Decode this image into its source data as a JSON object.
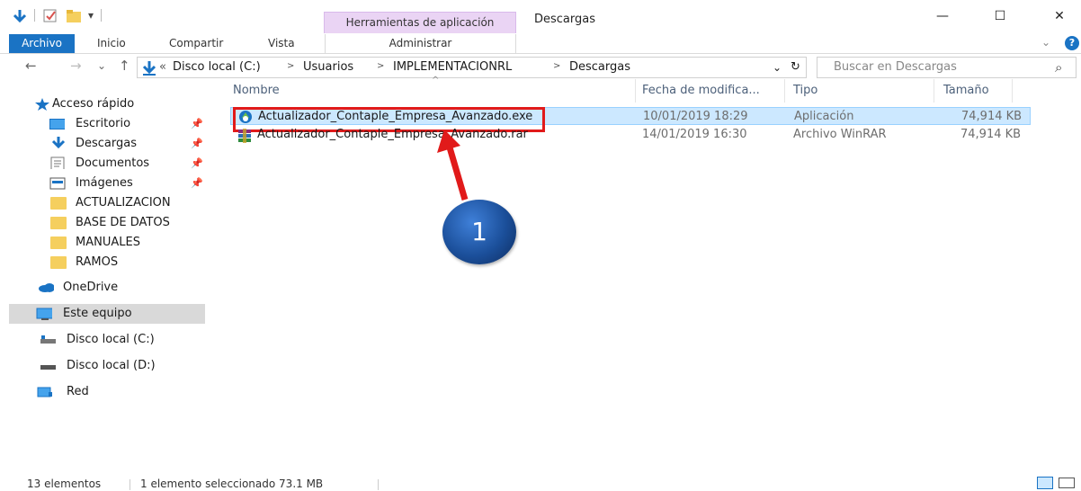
{
  "titlebar": {
    "context_tab": "Herramientas de aplicación",
    "window_title": "Descargas",
    "minimize": "—",
    "maximize": "☐",
    "close": "✕"
  },
  "ribbon": {
    "tabs": [
      "Archivo",
      "Inicio",
      "Compartir",
      "Vista",
      "Administrar"
    ],
    "help": "?"
  },
  "address": {
    "back": "←",
    "forward": "→",
    "recent": "⌄",
    "up": "↑",
    "overflow": "«",
    "crumbs": [
      "Disco local (C:)",
      "Usuarios",
      "IMPLEMENTACIONRL",
      "Descargas"
    ],
    "separator": ">",
    "dropdown": "⌄",
    "refresh": "↻",
    "search_placeholder": "Buscar en Descargas",
    "search_icon": "⌕"
  },
  "sidebar": {
    "quick_access": "Acceso rápido",
    "pinned": [
      {
        "label": "Escritorio",
        "icon": "desktop-icon"
      },
      {
        "label": "Descargas",
        "icon": "download-icon"
      },
      {
        "label": "Documentos",
        "icon": "documents-icon"
      },
      {
        "label": "Imágenes",
        "icon": "pictures-icon"
      }
    ],
    "folders": [
      "ACTUALIZACION",
      "BASE DE DATOS",
      "MANUALES",
      "RAMOS"
    ],
    "onedrive": "OneDrive",
    "this_pc": "Este equipo",
    "disk_c": "Disco local (C:)",
    "disk_d": "Disco local (D:)",
    "network": "Red"
  },
  "columns": {
    "name": "Nombre",
    "date": "Fecha de modifica...",
    "type": "Tipo",
    "size": "Tamaño",
    "sort_indicator": "^"
  },
  "files": [
    {
      "name": "Actualizador_Contaple_Empresa_Avanzado.exe",
      "date": "10/01/2019 18:29",
      "type": "Aplicación",
      "size": "74,914 KB",
      "selected": true
    },
    {
      "name": "Actualizador_Contaple_Empresa_Avanzado.rar",
      "date": "14/01/2019 16:30",
      "type": "Archivo WinRAR",
      "size": "74,914 KB",
      "selected": false
    }
  ],
  "annotation": {
    "badge": "1"
  },
  "status": {
    "count": "13 elementos",
    "selection": "1 elemento seleccionado  73.1 MB"
  },
  "colors": {
    "accent": "#1a73c4",
    "selection": "#cce8ff",
    "highlight_border": "#e11a1a",
    "badge": "#1b4f9a",
    "context_tab": "#ead4f4"
  }
}
